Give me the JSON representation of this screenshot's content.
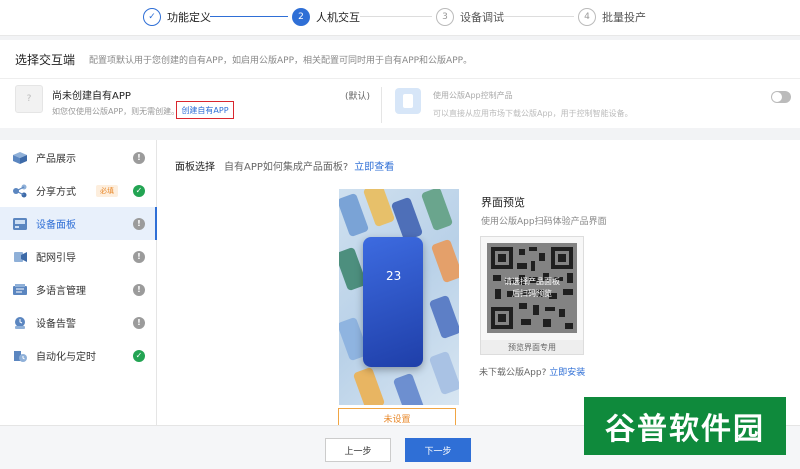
{
  "steps": [
    {
      "number": "✓",
      "label": "功能定义",
      "state": "done"
    },
    {
      "number": "2",
      "label": "人机交互",
      "state": "active"
    },
    {
      "number": "3",
      "label": "设备调试",
      "state": "todo"
    },
    {
      "number": "4",
      "label": "批量投产",
      "state": "todo"
    }
  ],
  "section": {
    "title": "选择交互端",
    "desc": "配置项默认用于您创建的自有APP，如启用公版APP，相关配置可同时用于自有APP和公版APP。"
  },
  "own_app": {
    "icon_text": "?",
    "title": "尚未创建自有APP",
    "subtitle": "如您仅使用公版APP，则无需创建。",
    "create_link": "创建自有APP",
    "default_tag": "(默认)"
  },
  "public_app": {
    "title": "使用公版App控制产品",
    "subtitle": "可以直接从应用市场下载公版App，用于控制智能设备。",
    "toggle_on": false
  },
  "sidebar": {
    "items": [
      {
        "label": "产品展示",
        "status": "warn",
        "status_glyph": "!"
      },
      {
        "label": "分享方式",
        "status": "ok",
        "status_glyph": "✓",
        "tag": "必填"
      },
      {
        "label": "设备面板",
        "status": "warn",
        "status_glyph": "!",
        "active": true
      },
      {
        "label": "配网引导",
        "status": "warn",
        "status_glyph": "!"
      },
      {
        "label": "多语言管理",
        "status": "warn",
        "status_glyph": "!"
      },
      {
        "label": "设备告警",
        "status": "warn",
        "status_glyph": "!"
      },
      {
        "label": "自动化与定时",
        "status": "ok",
        "status_glyph": "✓"
      }
    ]
  },
  "panel": {
    "title": "面板选择",
    "question": "自有APP如何集成产品面板?",
    "link": "立即查看",
    "phone_number": "23",
    "unset_button": "未设置"
  },
  "preview": {
    "title": "界面预览",
    "subtitle": "使用公版App扫码体验产品界面",
    "qr_overlay_line1": "请选择产品面板",
    "qr_overlay_line2": "后扫码预览",
    "qr_caption": "预览界面专用",
    "no_download": "未下载公版App?",
    "install_link": "立即安装"
  },
  "footer": {
    "prev": "上一步",
    "next": "下一步"
  },
  "watermark": {
    "text": "谷普软件园"
  },
  "colors": {
    "primary": "#2f6fd6",
    "success": "#23a453",
    "warning_gray": "#9b9b9b",
    "required": "#e8892c",
    "highlight_border": "#d9272e",
    "watermark_bg": "#0f8a3c"
  }
}
